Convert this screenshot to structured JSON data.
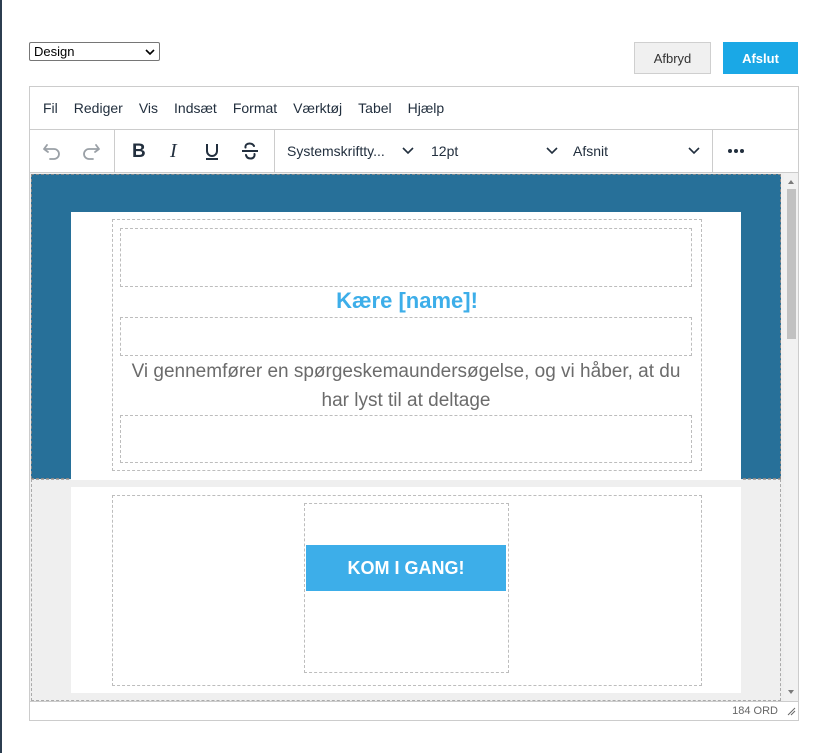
{
  "mode_select": {
    "value": "Design"
  },
  "actions": {
    "cancel_label": "Afbryd",
    "finish_label": "Afslut"
  },
  "menu": [
    "Fil",
    "Rediger",
    "Vis",
    "Indsæt",
    "Format",
    "Værktøj",
    "Tabel",
    "Hjælp"
  ],
  "toolbar": {
    "font_family": "Systemskriftty...",
    "font_size": "12pt",
    "block_format": "Afsnit",
    "icons": [
      "undo-icon",
      "redo-icon",
      "bold-icon",
      "italic-icon",
      "underline-icon",
      "strikethrough-icon",
      "more-icon"
    ]
  },
  "email": {
    "greeting": "Kære [name]!",
    "intro": "Vi gennemfører en spørgeskemaundersøgelse, og vi håber, at du har lyst til at deltage",
    "cta_label": "KOM I GANG!"
  },
  "statusbar": {
    "word_count": "184 ORD"
  },
  "colors": {
    "accent": "#1aa8e6",
    "band": "#277099",
    "heading": "#3daee9",
    "cta": "#3daee9"
  }
}
